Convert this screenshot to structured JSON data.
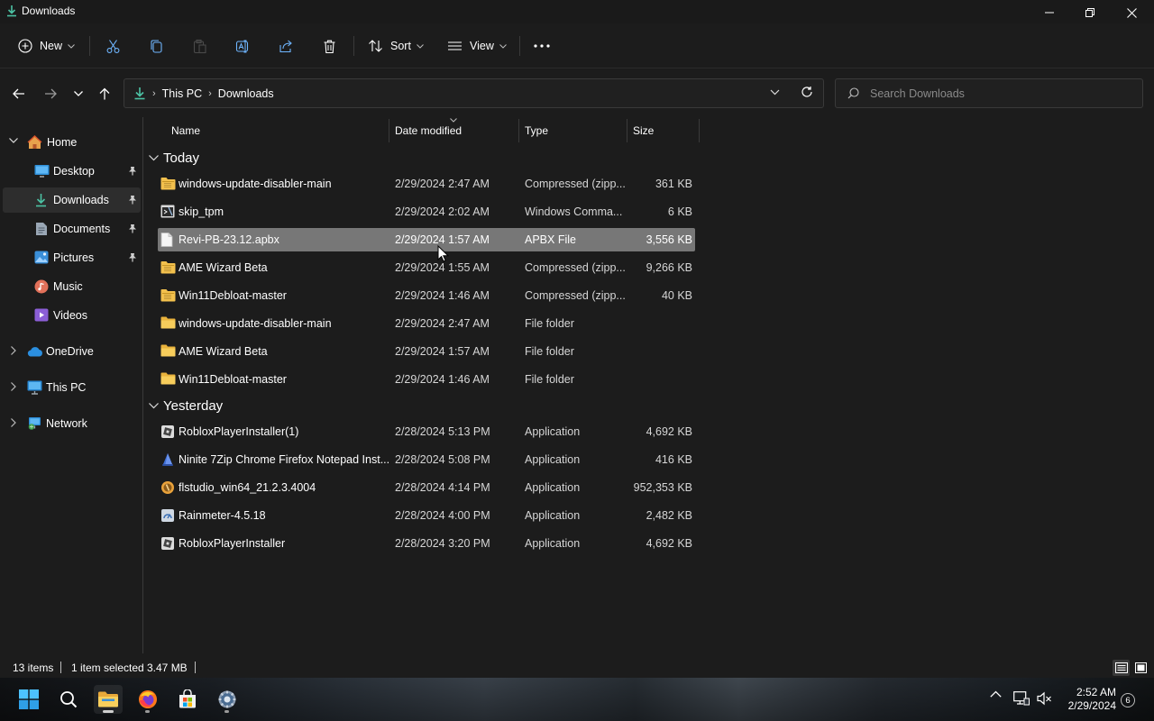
{
  "window": {
    "title": "Downloads"
  },
  "toolbar": {
    "new_label": "New",
    "sort_label": "Sort",
    "view_label": "View"
  },
  "address": {
    "crumbs": [
      "This PC",
      "Downloads"
    ]
  },
  "search": {
    "placeholder": "Search Downloads"
  },
  "sidebar": {
    "items": [
      {
        "label": "Home",
        "icon": "home-icon"
      },
      {
        "label": "Desktop",
        "icon": "desktop-icon",
        "pinned": true
      },
      {
        "label": "Downloads",
        "icon": "download-icon",
        "pinned": true,
        "selected": true
      },
      {
        "label": "Documents",
        "icon": "document-icon",
        "pinned": true
      },
      {
        "label": "Pictures",
        "icon": "pictures-icon",
        "pinned": true
      },
      {
        "label": "Music",
        "icon": "music-icon"
      },
      {
        "label": "Videos",
        "icon": "videos-icon"
      },
      {
        "label": "OneDrive",
        "icon": "onedrive-icon"
      },
      {
        "label": "This PC",
        "icon": "this-pc-icon"
      },
      {
        "label": "Network",
        "icon": "network-icon"
      }
    ]
  },
  "columns": {
    "name": "Name",
    "date": "Date modified",
    "type": "Type",
    "size": "Size"
  },
  "groups": {
    "today": "Today",
    "yesterday": "Yesterday"
  },
  "files": [
    {
      "name": "windows-update-disabler-main",
      "date": "2/29/2024 2:47 AM",
      "type": "Compressed (zipp...",
      "size": "361 KB",
      "icon": "zip-folder-icon"
    },
    {
      "name": "skip_tpm",
      "date": "2/29/2024 2:02 AM",
      "type": "Windows Comma...",
      "size": "6 KB",
      "icon": "cmd-script-icon"
    },
    {
      "name": "Revi-PB-23.12.apbx",
      "date": "2/29/2024 1:57 AM",
      "type": "APBX File",
      "size": "3,556 KB",
      "icon": "file-icon",
      "selected": true
    },
    {
      "name": "AME Wizard Beta",
      "date": "2/29/2024 1:55 AM",
      "type": "Compressed (zipp...",
      "size": "9,266 KB",
      "icon": "zip-folder-icon"
    },
    {
      "name": "Win11Debloat-master",
      "date": "2/29/2024 1:46 AM",
      "type": "Compressed (zipp...",
      "size": "40 KB",
      "icon": "zip-folder-icon"
    },
    {
      "name": "windows-update-disabler-main",
      "date": "2/29/2024 2:47 AM",
      "type": "File folder",
      "size": "",
      "icon": "folder-icon"
    },
    {
      "name": "AME Wizard Beta",
      "date": "2/29/2024 1:57 AM",
      "type": "File folder",
      "size": "",
      "icon": "folder-icon"
    },
    {
      "name": "Win11Debloat-master",
      "date": "2/29/2024 1:46 AM",
      "type": "File folder",
      "size": "",
      "icon": "folder-icon"
    },
    {
      "name": "RobloxPlayerInstaller(1)",
      "date": "2/28/2024 5:13 PM",
      "type": "Application",
      "size": "4,692 KB",
      "icon": "roblox-icon"
    },
    {
      "name": "Ninite 7Zip Chrome Firefox Notepad Inst...",
      "date": "2/28/2024 5:08 PM",
      "type": "Application",
      "size": "416 KB",
      "icon": "ninite-icon"
    },
    {
      "name": "flstudio_win64_21.2.3.4004",
      "date": "2/28/2024 4:14 PM",
      "type": "Application",
      "size": "952,353 KB",
      "icon": "flstudio-icon"
    },
    {
      "name": "Rainmeter-4.5.18",
      "date": "2/28/2024 4:00 PM",
      "type": "Application",
      "size": "2,482 KB",
      "icon": "rainmeter-icon"
    },
    {
      "name": "RobloxPlayerInstaller",
      "date": "2/28/2024 3:20 PM",
      "type": "Application",
      "size": "4,692 KB",
      "icon": "roblox-icon"
    }
  ],
  "status": {
    "count": "13 items",
    "selection": "1 item selected",
    "size": "3.47 MB"
  },
  "taskbar": {
    "time": "2:52 AM",
    "date": "2/29/2024",
    "notifications": "6"
  }
}
